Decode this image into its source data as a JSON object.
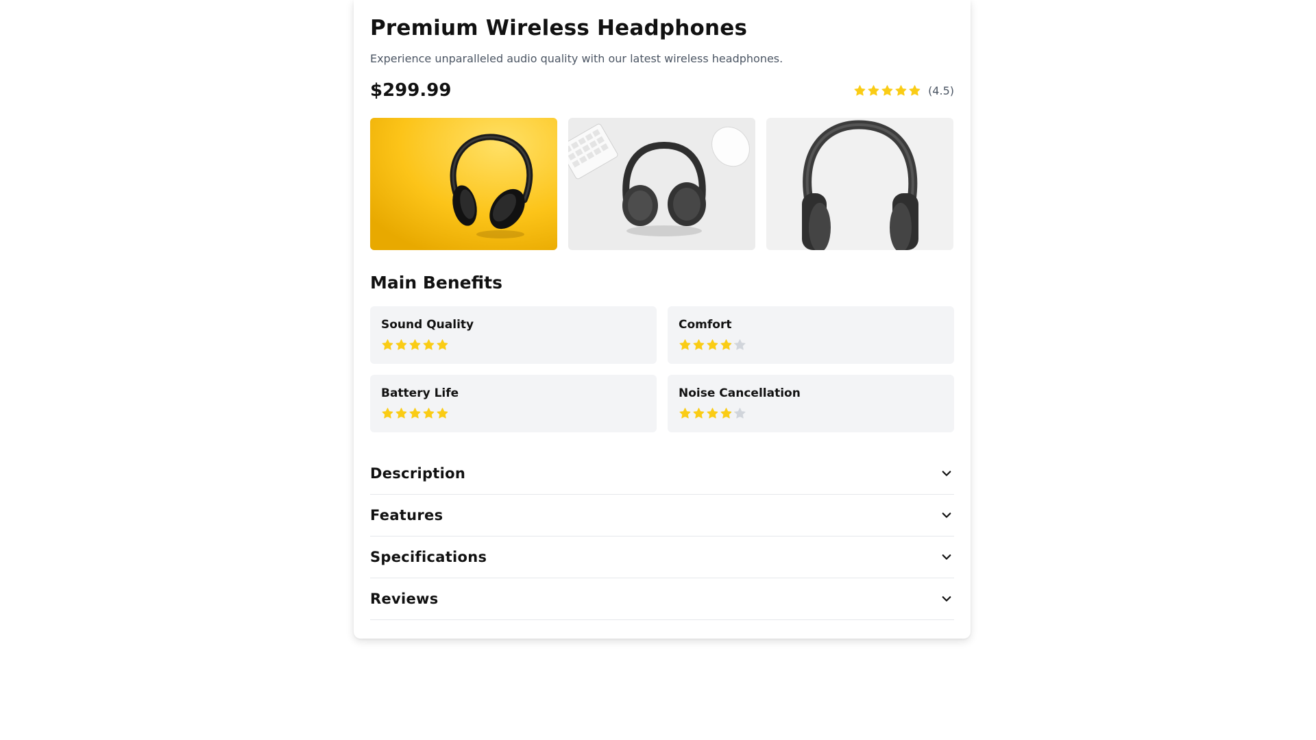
{
  "product": {
    "title": "Premium Wireless Headphones",
    "subtitle": "Experience unparalleled audio quality with our latest wireless headphones.",
    "price": "$299.99",
    "rating": 4.5,
    "rating_label": "(4.5)"
  },
  "gallery": {
    "images": [
      {
        "alt": "headphones-on-yellow-background"
      },
      {
        "alt": "headphones-with-keyboard-and-mouse"
      },
      {
        "alt": "headphones-on-white-background"
      }
    ]
  },
  "benefits": {
    "title": "Main Benefits",
    "items": [
      {
        "label": "Sound Quality",
        "rating": 5
      },
      {
        "label": "Comfort",
        "rating": 4
      },
      {
        "label": "Battery Life",
        "rating": 5
      },
      {
        "label": "Noise Cancellation",
        "rating": 4
      }
    ]
  },
  "accordion": {
    "items": [
      {
        "label": "Description",
        "icon": "chevron-down-icon"
      },
      {
        "label": "Features",
        "icon": "chevron-down-icon"
      },
      {
        "label": "Specifications",
        "icon": "chevron-down-icon"
      },
      {
        "label": "Reviews",
        "icon": "chevron-down-icon"
      }
    ]
  },
  "colors": {
    "star_filled": "#facc15",
    "star_empty": "#d1d5db",
    "benefit_bg": "#f3f4f6",
    "text_muted": "#4b5563"
  }
}
